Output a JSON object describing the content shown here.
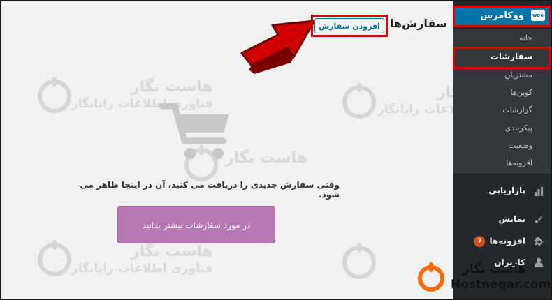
{
  "sidebar": {
    "woocommerce_label": "ووکامرس",
    "woo_badge": "woo",
    "submenu": [
      {
        "label": "خانه"
      },
      {
        "label": "سفارشات"
      },
      {
        "label": "مشتریان"
      },
      {
        "label": "کوپن‌ها"
      },
      {
        "label": "گزارشات"
      },
      {
        "label": "پیکربندی"
      },
      {
        "label": "وضعیت"
      },
      {
        "label": "افزونه‌ها"
      }
    ],
    "menu": [
      {
        "label": "بازاریابی",
        "icon": "chart-icon"
      },
      {
        "label": "نمایش",
        "icon": "brush-icon"
      },
      {
        "label": "افزونه‌ها",
        "icon": "plugin-icon",
        "count": "7"
      },
      {
        "label": "کاربران",
        "icon": "user-icon"
      }
    ]
  },
  "header": {
    "title": "سفارش‌ها",
    "add_button": "افزودن سفارش"
  },
  "empty_state": {
    "message": "وقتی سفارش جدیدی را دریافت می کنید، آن در اینجا ظاهر می شود.",
    "button": "در مورد سفارشات بیشتر بدانید"
  },
  "watermark": {
    "line1": "هاست نگار",
    "line2": "فناوری اطلاعات رایانگار"
  },
  "logo": {
    "fa": "هاست نگار",
    "en": "Hostnegar.com"
  },
  "colors": {
    "accent": "#0073aa",
    "sidebar": "#23282d",
    "button_purple": "#b678b3",
    "highlight": "#dd0000",
    "arrow": "#d10000",
    "logo_orange": "#ff6a00"
  }
}
